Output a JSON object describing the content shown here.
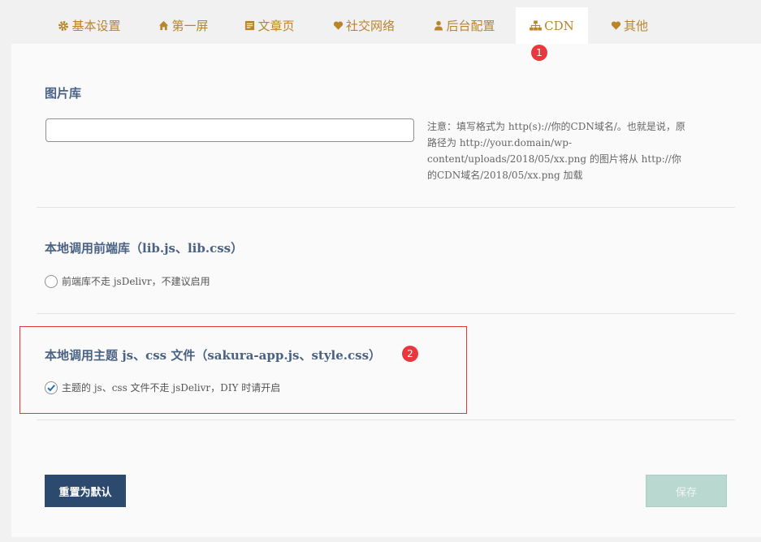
{
  "tabs": [
    {
      "label": "基本设置",
      "icon": "gear-icon"
    },
    {
      "label": "第一屏",
      "icon": "home-icon"
    },
    {
      "label": "文章页",
      "icon": "document-icon"
    },
    {
      "label": "社交网络",
      "icon": "heart-icon"
    },
    {
      "label": "后台配置",
      "icon": "user-icon"
    },
    {
      "label": "CDN",
      "icon": "sitemap-icon",
      "active": true
    },
    {
      "label": "其他",
      "icon": "heart-icon"
    }
  ],
  "badges": {
    "first": "1",
    "second": "2"
  },
  "sections": {
    "image_library": {
      "title": "图片库",
      "input_value": "",
      "note": "注意：填写格式为 http(s)://你的CDN域名/。也就是说，原路径为 http://your.domain/wp-content/uploads/2018/05/xx.png 的图片将从 http://你的CDN域名/2018/05/xx.png 加载"
    },
    "local_frontend": {
      "title": "本地调用前端库（lib.js、lib.css）",
      "option_label": "前端库不走 jsDelivr，不建议启用",
      "checked": false
    },
    "local_theme": {
      "title": "本地调用主题 js、css 文件（sakura-app.js、style.css）",
      "option_label": "主题的 js、css 文件不走 jsDelivr，DIY 时请开启",
      "checked": true
    }
  },
  "buttons": {
    "reset": "重置为默认",
    "save": "保存"
  },
  "colors": {
    "accent": "#b8852b",
    "title": "#4a6283",
    "badge": "#e8383d",
    "reset_bg": "#2c4a6e",
    "save_bg": "#b8d8d0",
    "check": "#2271b1"
  }
}
